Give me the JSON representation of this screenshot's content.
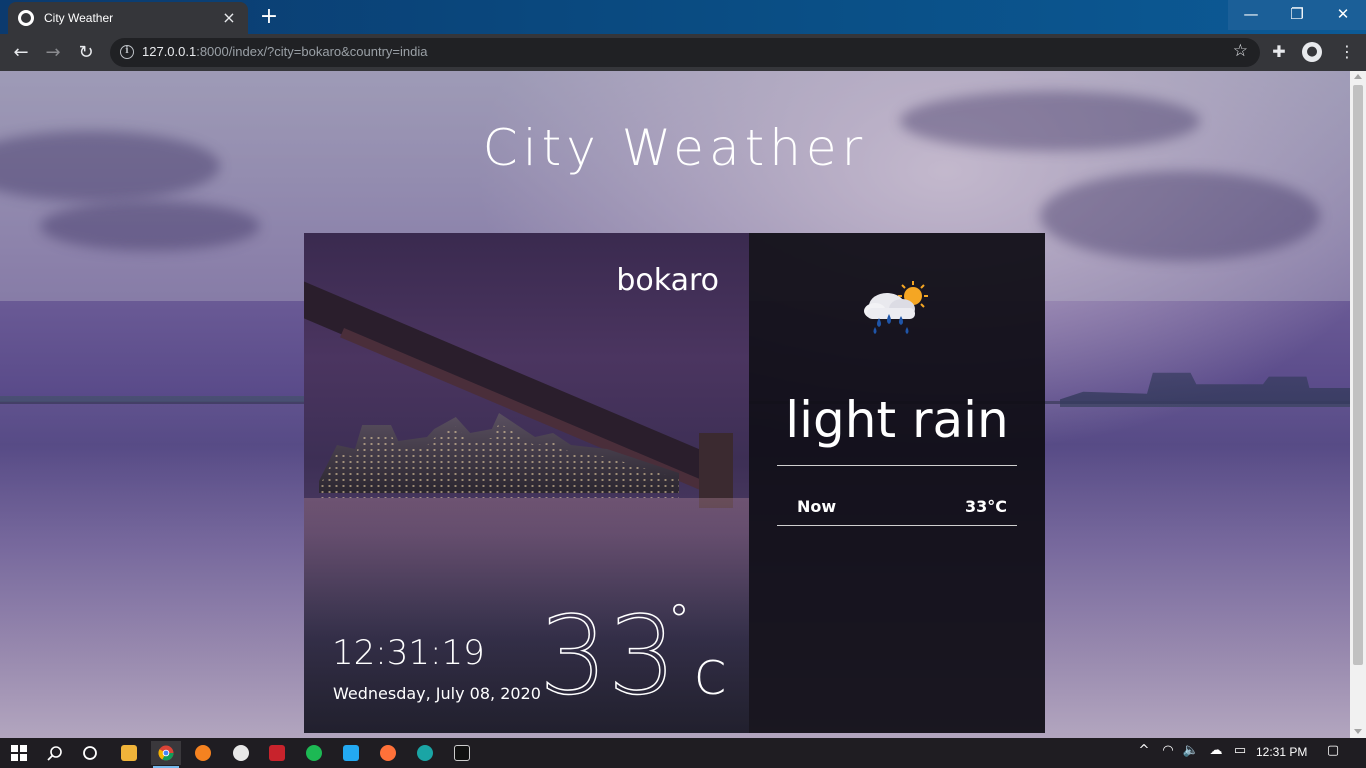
{
  "browser": {
    "tab_title": "City Weather",
    "tab_close": "×",
    "new_tab": "+",
    "url_host": "127.0.0.1",
    "url_path": ":8000/index/?city=bokaro&country=india",
    "window_controls": {
      "minimize": "—",
      "maximize": "❐",
      "close": "✕"
    }
  },
  "page": {
    "title": "City Weather",
    "city": "bokaro",
    "time": "12:31:19",
    "date": "Wednesday, July 08, 2020",
    "temperature": "33",
    "degree_symbol": "°",
    "unit": "C",
    "condition": "light rain",
    "forecast": {
      "label": "Now",
      "value": "33°C"
    },
    "weather_icon": "rain-cloud-sun-icon"
  },
  "taskbar": {
    "clock": "12:31 PM",
    "apps": [
      "file-explorer-icon",
      "chrome-icon",
      "app-orange-icon",
      "app-weather-icon",
      "app-download-icon",
      "spotify-icon",
      "vscode-icon",
      "firefox-icon",
      "edge-icon",
      "terminal-icon"
    ]
  },
  "colors": {
    "tabbar": "#0b3a6e",
    "chrome_dark": "#35363a",
    "card_right": "#100e16",
    "taskbar_accent": "#76b9ed"
  }
}
